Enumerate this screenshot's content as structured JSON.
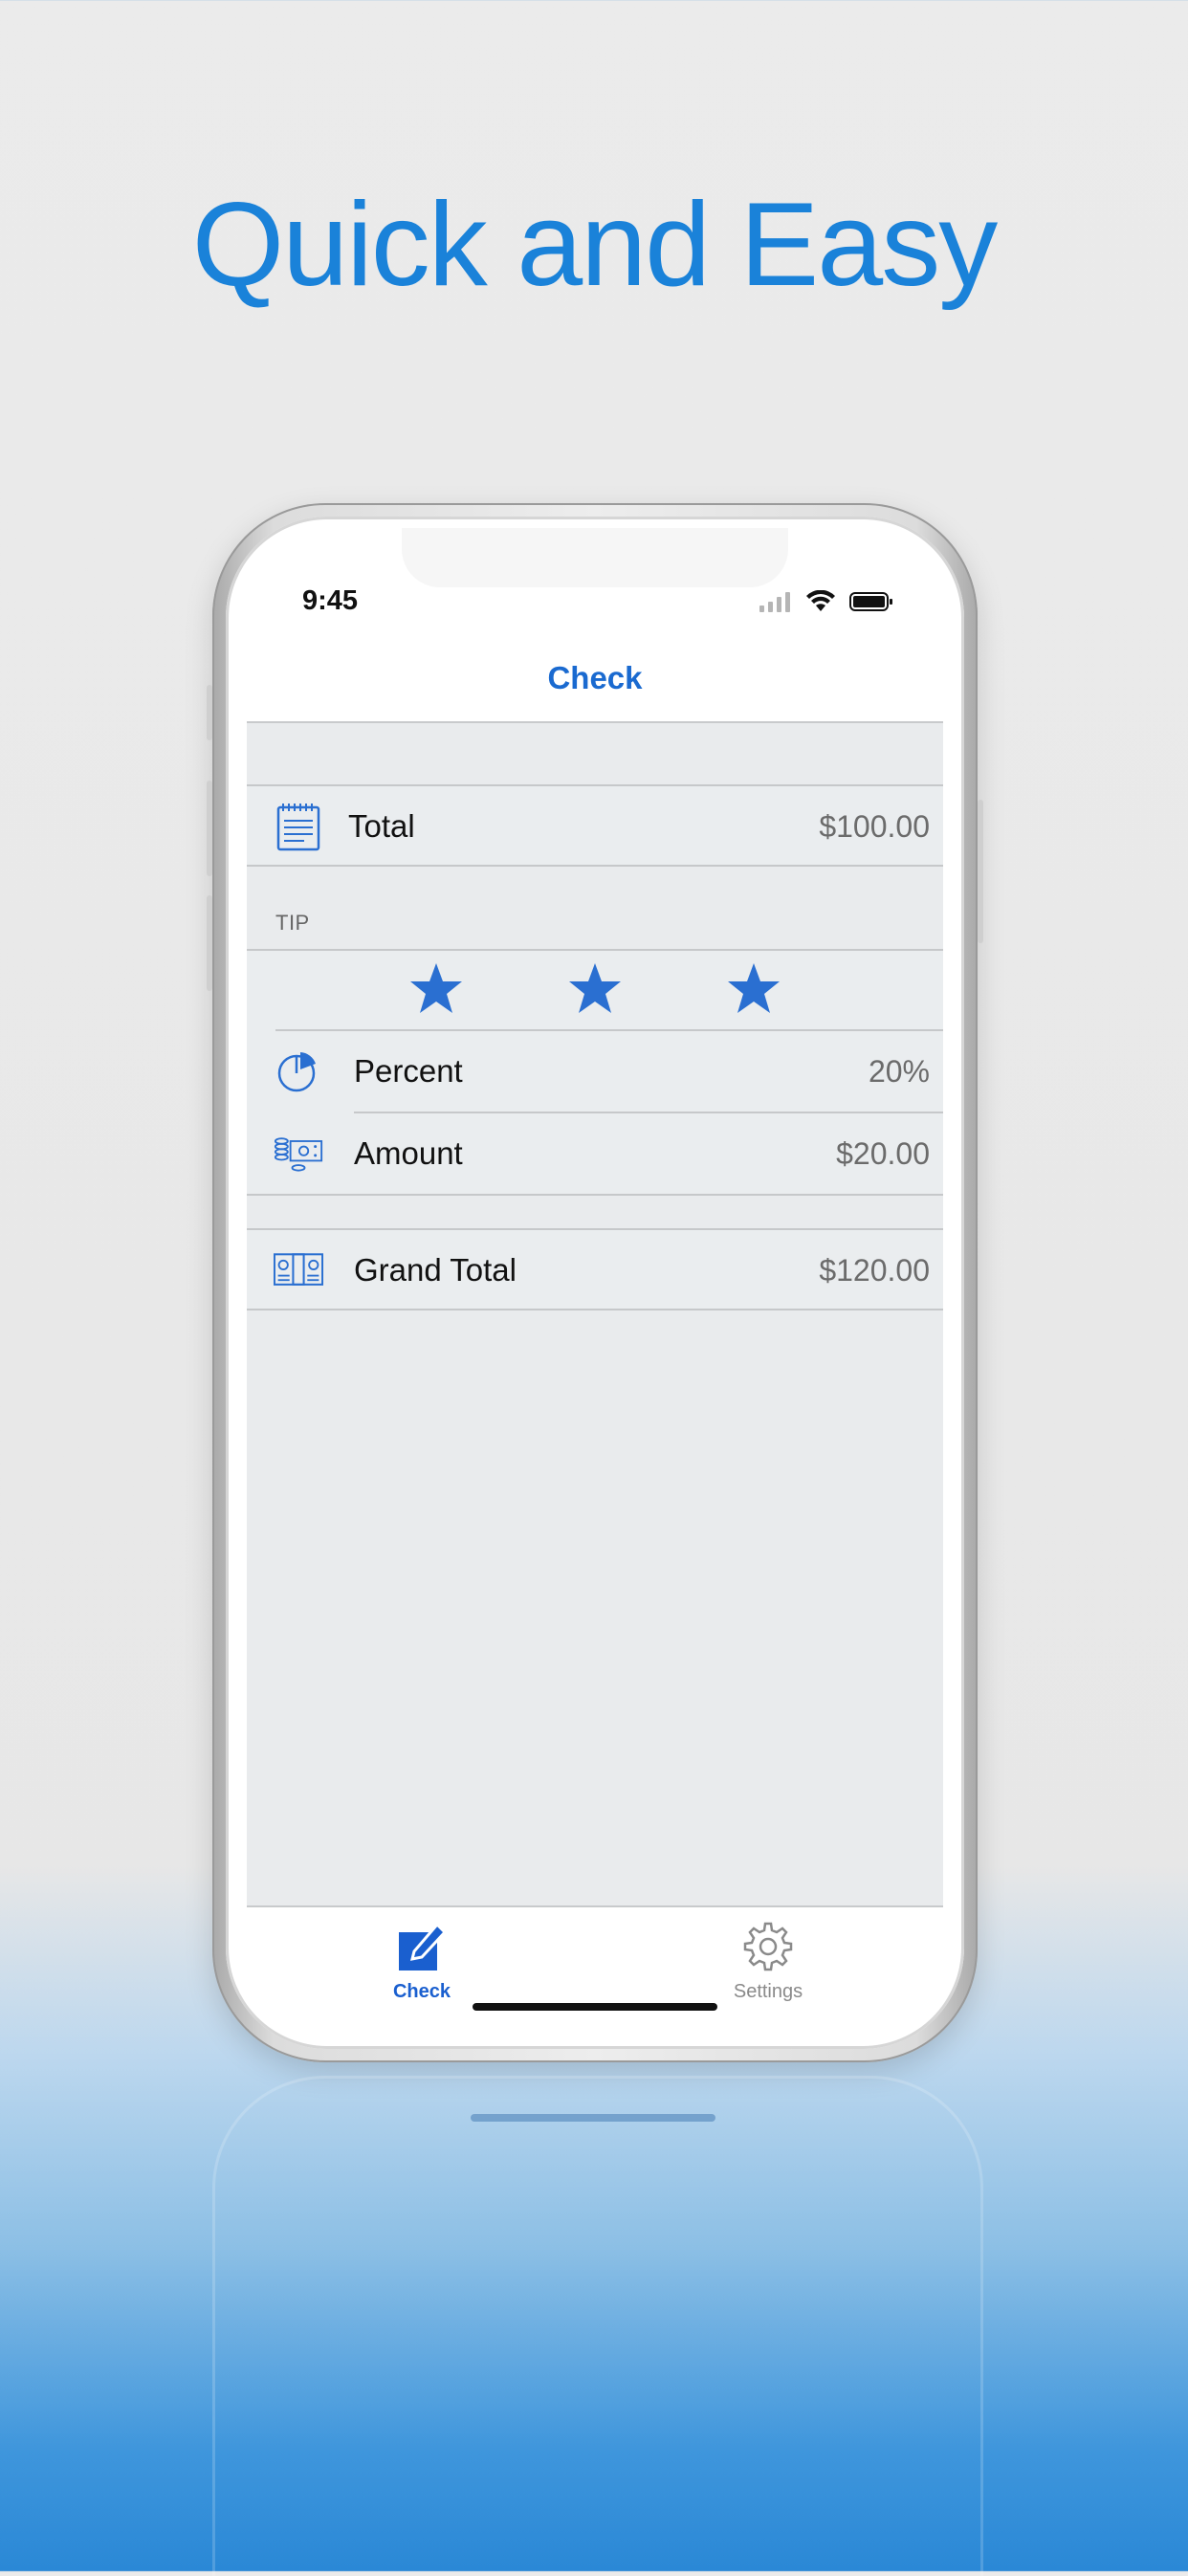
{
  "headline": "Quick and Easy",
  "status": {
    "time": "9:45"
  },
  "nav": {
    "title": "Check"
  },
  "total_row": {
    "label": "Total",
    "value": "$100.00",
    "icon": "notepad-icon"
  },
  "tip": {
    "header": "TIP",
    "rating_stars": 3,
    "percent": {
      "label": "Percent",
      "value": "20%",
      "icon": "pie-chart-icon"
    },
    "amount": {
      "label": "Amount",
      "value": "$20.00",
      "icon": "money-coins-icon"
    }
  },
  "grand_total_row": {
    "label": "Grand Total",
    "value": "$120.00",
    "icon": "cash-bundle-icon"
  },
  "tabbar": {
    "tabs": [
      {
        "label": "Check",
        "icon": "edit-pencil-icon",
        "selected": true
      },
      {
        "label": "Settings",
        "icon": "gear-icon",
        "selected": false
      }
    ]
  },
  "colors": {
    "accent": "#1a6ad0",
    "headline": "#1a82d9",
    "star": "#2a6fd1"
  }
}
